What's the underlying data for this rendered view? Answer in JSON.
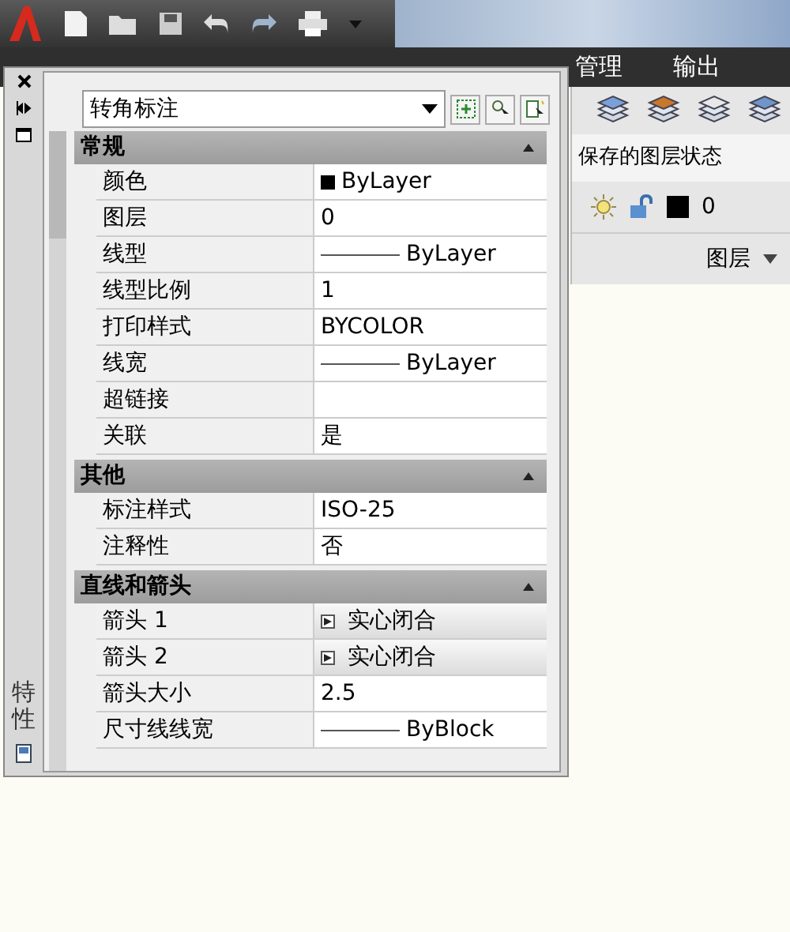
{
  "ribbon_tabs": [
    {
      "label": "管理",
      "selected": false
    },
    {
      "label": "输出",
      "selected": false
    }
  ],
  "layers_panel": {
    "layer_state": "保存的图层状态",
    "current_layer": "0",
    "title": "图层"
  },
  "palette": {
    "side_title": "特性",
    "selector": "转角标注",
    "sections": [
      {
        "title": "常规",
        "expanded": true,
        "rows": [
          {
            "label": "颜色",
            "value": "ByLayer",
            "kind": "color"
          },
          {
            "label": "图层",
            "value": "0",
            "kind": "text"
          },
          {
            "label": "线型",
            "value": "ByLayer",
            "kind": "line"
          },
          {
            "label": "线型比例",
            "value": "1",
            "kind": "text"
          },
          {
            "label": "打印样式",
            "value": "BYCOLOR",
            "kind": "text"
          },
          {
            "label": "线宽",
            "value": "ByLayer",
            "kind": "line"
          },
          {
            "label": "超链接",
            "value": "",
            "kind": "text"
          },
          {
            "label": "关联",
            "value": "是",
            "kind": "text"
          }
        ]
      },
      {
        "title": "其他",
        "expanded": true,
        "rows": [
          {
            "label": "标注样式",
            "value": "ISO-25",
            "kind": "text"
          },
          {
            "label": "注释性",
            "value": "否",
            "kind": "text"
          }
        ]
      },
      {
        "title": "直线和箭头",
        "expanded": true,
        "rows": [
          {
            "label": "箭头 1",
            "value": "实心闭合",
            "kind": "arrow"
          },
          {
            "label": "箭头 2",
            "value": "实心闭合",
            "kind": "arrow"
          },
          {
            "label": "箭头大小",
            "value": "2.5",
            "kind": "text"
          },
          {
            "label": "尺寸线线宽",
            "value": "ByBlock",
            "kind": "line"
          }
        ]
      }
    ]
  }
}
